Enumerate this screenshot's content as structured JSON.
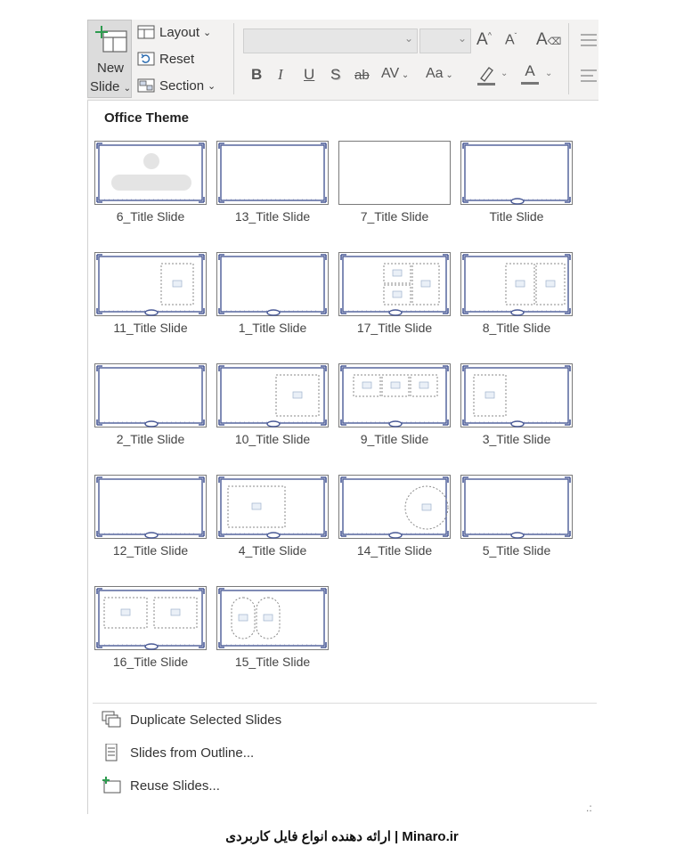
{
  "ribbon": {
    "new_slide_line1": "New",
    "new_slide_line2": "Slide",
    "layout_label": "Layout",
    "reset_label": "Reset",
    "section_label": "Section",
    "bold": "B",
    "italic": "I",
    "underline": "U",
    "shadow": "S",
    "strike": "ab",
    "spacing": "AV",
    "case": "Aa"
  },
  "gallery": {
    "title": "Office Theme",
    "layouts": [
      {
        "label": "6_Title Slide",
        "variant": "title"
      },
      {
        "label": "13_Title Slide",
        "variant": "frame"
      },
      {
        "label": "7_Title Slide",
        "variant": "blank"
      },
      {
        "label": "Title Slide",
        "variant": "frame-pill"
      },
      {
        "label": "11_Title Slide",
        "variant": "right-pic"
      },
      {
        "label": "1_Title Slide",
        "variant": "frame-pill"
      },
      {
        "label": "17_Title Slide",
        "variant": "three-pics"
      },
      {
        "label": "8_Title Slide",
        "variant": "two-pics"
      },
      {
        "label": "2_Title Slide",
        "variant": "frame-pill"
      },
      {
        "label": "10_Title Slide",
        "variant": "right-pic-big"
      },
      {
        "label": "9_Title Slide",
        "variant": "three-row"
      },
      {
        "label": "3_Title Slide",
        "variant": "left-pic"
      },
      {
        "label": "12_Title Slide",
        "variant": "frame-pill"
      },
      {
        "label": "4_Title Slide",
        "variant": "big-pic"
      },
      {
        "label": "14_Title Slide",
        "variant": "circle-pic"
      },
      {
        "label": "5_Title Slide",
        "variant": "frame-pill"
      },
      {
        "label": "16_Title Slide",
        "variant": "two-wide"
      },
      {
        "label": "15_Title Slide",
        "variant": "ovals"
      }
    ]
  },
  "commands": {
    "duplicate": "Duplicate Selected Slides",
    "outline": "Slides from Outline...",
    "reuse": "Reuse Slides..."
  },
  "footer": "Minaro.ir | ارائه دهنده انواع فایل کاربردی",
  "colors": {
    "frame": "#4a5a96",
    "placeholder": "#8a8a8a",
    "accent_green": "#2e9b4f"
  }
}
